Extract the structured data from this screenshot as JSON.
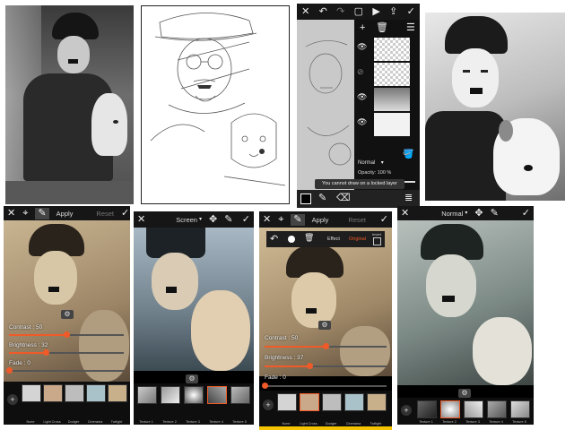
{
  "panel3_editor": {
    "layers_mode": "Normal",
    "opacity_label": "Opacity: 100 %",
    "toast": "You cannot draw on a locked layer"
  },
  "panel4_toolbar": {
    "apply": "Apply",
    "reset": "Reset"
  },
  "panel4_sliders": {
    "contrast": "Contrast : 50",
    "brightness": "Brightness : 32",
    "fade": "Fade : 0",
    "contrast_value": 50,
    "brightness_value": 32,
    "fade_value": 0
  },
  "panel4_effects": [
    {
      "label": "None"
    },
    {
      "label": "Light Cross"
    },
    {
      "label": "Dodger"
    },
    {
      "label": "Cinerama"
    },
    {
      "label": "Twilight"
    }
  ],
  "panel5_toolbar": {
    "mode": "Screen"
  },
  "panel5_textures": [
    {
      "label": "Texture 1"
    },
    {
      "label": "Texture 2"
    },
    {
      "label": "Texture 3"
    },
    {
      "label": "Texture 4"
    },
    {
      "label": "Texture 5"
    }
  ],
  "panel6_toolbar": {
    "apply": "Apply",
    "reset": "Reset",
    "effect": "Effect",
    "original": "Original",
    "invert": "Invert"
  },
  "panel6_sliders": {
    "contrast": "Contrast : 50",
    "brightness": "Brightness : 37",
    "fade": "Fade : 0",
    "contrast_value": 50,
    "brightness_value": 37,
    "fade_value": 0
  },
  "panel6_effects": [
    {
      "label": "None"
    },
    {
      "label": "Light Cross"
    },
    {
      "label": "Dodger"
    },
    {
      "label": "Cinerama"
    },
    {
      "label": "Twilight"
    }
  ],
  "panel7_toolbar": {
    "mode": "Normal"
  },
  "panel7_textures": [
    {
      "label": "Texture 1"
    },
    {
      "label": "Texture 2"
    },
    {
      "label": "Texture 3"
    },
    {
      "label": "Texture 4"
    },
    {
      "label": "Texture 5"
    }
  ],
  "colors": {
    "accent": "#f05a28",
    "highlight_bar": "#f5c400",
    "toolbar_bg": "#161616"
  }
}
